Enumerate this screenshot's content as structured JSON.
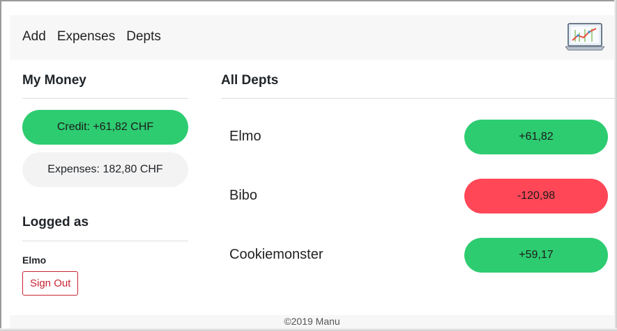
{
  "nav": {
    "items": [
      "Add",
      "Expenses",
      "Depts"
    ],
    "logo_icon": "chart-laptop-icon"
  },
  "sidebar": {
    "title": "My Money",
    "credit": "Credit: +61,82 CHF",
    "expenses": "Expenses: 182,80 CHF",
    "logged_title": "Logged as",
    "username": "Elmo",
    "signout_label": "Sign Out"
  },
  "main": {
    "title": "All Depts",
    "depts": [
      {
        "name": "Elmo",
        "amount": "+61,82",
        "status": "positive"
      },
      {
        "name": "Bibo",
        "amount": "-120,98",
        "status": "negative"
      },
      {
        "name": "Cookiemonster",
        "amount": "+59,17",
        "status": "positive"
      }
    ]
  },
  "footer": {
    "text": "©2019 Manu"
  },
  "colors": {
    "positive": "#2ecc71",
    "negative": "#ff4757",
    "neutral": "#f3f3f3",
    "danger": "#c82333"
  }
}
